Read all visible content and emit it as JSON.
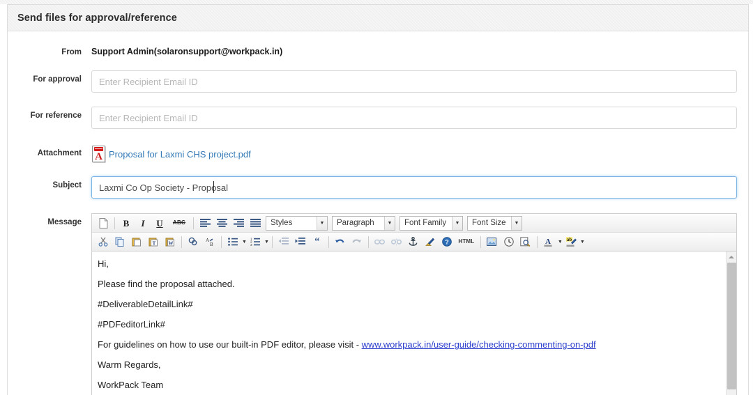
{
  "card": {
    "title": "Send files for approval/reference"
  },
  "form": {
    "from": {
      "label": "From",
      "value": "Support Admin(solaronsupport@workpack.in)"
    },
    "for_approval": {
      "label": "For approval",
      "value": "",
      "placeholder": "Enter Recipient Email ID"
    },
    "for_reference": {
      "label": "For reference",
      "value": "",
      "placeholder": "Enter Recipient Email ID"
    },
    "attachment": {
      "label": "Attachment",
      "icon": "pdf-file-icon",
      "icon_glyph": "A",
      "filename": "Proposal for Laxmi CHS project.pdf"
    },
    "subject": {
      "label": "Subject",
      "value": "Laxmi Co Op Society - Proposal",
      "placeholder": "",
      "focused": true
    },
    "message": {
      "label": "Message"
    }
  },
  "editor": {
    "toolbar_row1": [
      {
        "name": "new-document-icon",
        "glyph": "⬜",
        "type": "button"
      },
      {
        "name": "separator",
        "type": "sep"
      },
      {
        "name": "bold-icon",
        "glyph": "B",
        "type": "button"
      },
      {
        "name": "italic-icon",
        "glyph": "I",
        "type": "button"
      },
      {
        "name": "underline-icon",
        "glyph": "U",
        "type": "button"
      },
      {
        "name": "strikethrough-icon",
        "glyph": "ABC",
        "type": "button"
      },
      {
        "name": "separator",
        "type": "sep"
      },
      {
        "name": "align-left-icon",
        "type": "button"
      },
      {
        "name": "align-center-icon",
        "type": "button"
      },
      {
        "name": "align-right-icon",
        "type": "button"
      },
      {
        "name": "align-justify-icon",
        "type": "button"
      }
    ],
    "selects": {
      "styles": "Styles",
      "paragraph": "Paragraph",
      "font_family": "Font Family",
      "font_size": "Font Size"
    },
    "toolbar_row2": [
      {
        "name": "cut-icon"
      },
      {
        "name": "copy-icon"
      },
      {
        "name": "paste-icon"
      },
      {
        "name": "paste-as-text-icon"
      },
      {
        "name": "paste-from-word-icon"
      },
      {
        "name": "find-icon"
      },
      {
        "name": "find-replace-icon"
      },
      {
        "name": "bullet-list-icon"
      },
      {
        "name": "numbered-list-icon"
      },
      {
        "name": "outdent-icon"
      },
      {
        "name": "indent-icon"
      },
      {
        "name": "blockquote-icon"
      },
      {
        "name": "undo-icon"
      },
      {
        "name": "redo-icon"
      },
      {
        "name": "insert-link-icon"
      },
      {
        "name": "unlink-icon"
      },
      {
        "name": "anchor-icon"
      },
      {
        "name": "cleanup-icon"
      },
      {
        "name": "help-icon"
      },
      {
        "name": "html-source-icon",
        "glyph": "HTML"
      },
      {
        "name": "insert-image-icon"
      },
      {
        "name": "insert-time-icon"
      },
      {
        "name": "preview-icon"
      },
      {
        "name": "text-color-icon",
        "glyph": "A"
      },
      {
        "name": "highlight-color-icon",
        "glyph": "ab"
      }
    ],
    "content": {
      "lines": [
        {
          "text": "Hi,"
        },
        {
          "text": "Please find the proposal attached."
        },
        {
          "text": "#DeliverableDetailLink#"
        },
        {
          "text": "#PDFeditorLink#"
        },
        {
          "text": "For guidelines on how to use our built-in PDF editor, please visit - ",
          "link": "www.workpack.in/user-guide/checking-commenting-on-pdf"
        },
        {
          "text": "Warm Regards,"
        },
        {
          "text": "WorkPack Team"
        }
      ]
    },
    "scrollbar": {
      "name": "editor-vertical-scrollbar"
    }
  },
  "colors": {
    "link": "#337ab7",
    "body_link": "#2b3ecc",
    "focus_border": "#7eb4e2",
    "pdf_red": "#cc1f1f",
    "border": "#dddddd"
  }
}
